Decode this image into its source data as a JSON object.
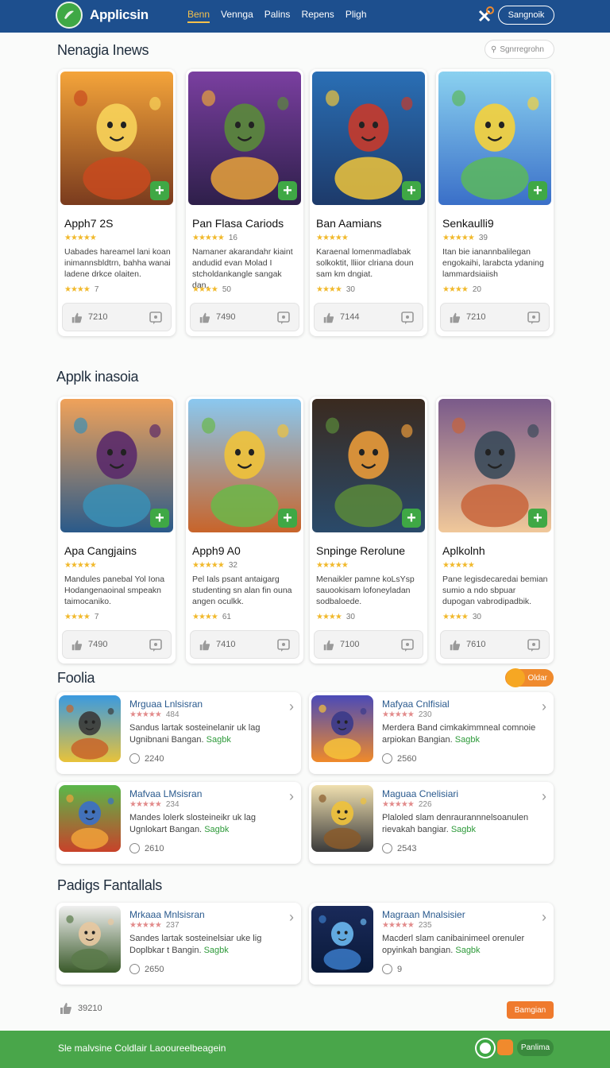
{
  "header": {
    "brand": "Applicsin",
    "nav": [
      "Benn",
      "Vennga",
      "Palins",
      "Repens",
      "Pligh"
    ],
    "signin_label": "Sangnoik"
  },
  "search": {
    "placeholder": "Sgnrregrohn"
  },
  "section1": {
    "title": "Nenagia Inews",
    "cards": [
      {
        "title": "Apph7 2S",
        "rating_count": "",
        "desc": "Uabades hareamel lani koan inimannsbldtrn, bahha wanai ladene drkce olaiten.",
        "stars2_count": "7",
        "footer_count": "7210",
        "art": "hero"
      },
      {
        "title": "Pan Flasa Cariods",
        "rating_count": "16",
        "desc": "Namaner akarandahr kiaint andudid evan Molad I stcholdankangle sangak dan.",
        "stars2_count": "50",
        "footer_count": "7490",
        "art": "soldier"
      },
      {
        "title": "Ban Aamians",
        "rating_count": "",
        "desc": "Karaenal lomenmadlabak solkoktit, lliior clriana doun sam km dngiat.",
        "stars2_count": "30",
        "footer_count": "7144",
        "art": "truck"
      },
      {
        "title": "Senkaulli9",
        "rating_count": "39",
        "desc": "Itan bie ianannbalilegan engokaihi, larabcta ydaning lammardsiaiish",
        "stars2_count": "20",
        "footer_count": "7210",
        "art": "kid"
      }
    ]
  },
  "section2": {
    "title": "Applk inasoia",
    "cards": [
      {
        "title": "Apa Cangjains",
        "rating_count": "",
        "desc": "Mandules panebal Yol Iona Hodangenaoinal smpeakn taimocaniko.",
        "stars2_count": "7",
        "footer_count": "7490",
        "art": "dragon"
      },
      {
        "title": "Apph9 A0",
        "rating_count": "32",
        "desc": "Pel Ials psant antaigarg studenting sn alan fin ouna angen oculkk.",
        "stars2_count": "61",
        "footer_count": "7410",
        "art": "village"
      },
      {
        "title": "Snpinge Rerolune",
        "rating_count": "",
        "desc": "Menaikler pamne koLsYsp sauookisam lofoneyladan sodbaloede.",
        "stars2_count": "30",
        "footer_count": "7100",
        "art": "fighter"
      },
      {
        "title": "Aplkolnh",
        "rating_count": "",
        "desc": "Pane legisdecaredai bemian sumio a ndo sbpuar dupogan vabrodipadbik.",
        "stars2_count": "30",
        "footer_count": "7610",
        "art": "crew"
      }
    ]
  },
  "section3": {
    "title": "Foolia",
    "older_label": "Oldar",
    "items": [
      {
        "title": "Mrguaa Lnlsisran",
        "rating_count": "484",
        "desc": "Sandus lartak sosteinelanir uk lag Ugnibnani Bangan.",
        "tag": "Sagbk",
        "count": "2240",
        "art": "warrior"
      },
      {
        "title": "Mafyaa Cnlfisial",
        "rating_count": "230",
        "desc": "Merdera Band cimkakimmneal comnoie arpiokan Bangian.",
        "tag": "Sagbk",
        "count": "2560",
        "art": "blob"
      },
      {
        "title": "Mafvaa LMsisran",
        "rating_count": "234",
        "desc": "Mandes lolerk slosteineikr uk lag Ugnlokart Bangan.",
        "tag": "Sagbk",
        "count": "2610",
        "art": "bear"
      },
      {
        "title": "Maguaa Cnelisiari",
        "rating_count": "226",
        "desc": "Plaloled slam denraurannnelsoanulen rievakah bangiar.",
        "tag": "Sagbk",
        "count": "2543",
        "art": "pirate"
      }
    ]
  },
  "section4": {
    "title": "Padigs Fantallals",
    "items": [
      {
        "title": "Mrkaaa Mnlsisran",
        "rating_count": "237",
        "desc": "Sandes lartak sosteinelsiar uke lig Doplbkar t Bangin.",
        "tag": "Sagbk",
        "count": "2650",
        "art": "duo"
      },
      {
        "title": "Magraan Mnalsisier",
        "rating_count": "235",
        "desc": "Macderl slam canibainimeel orenuler opyinkah bangian.",
        "tag": "Sagbk",
        "count": "9",
        "art": "space"
      }
    ]
  },
  "bottom": {
    "like_count": "39210",
    "button_label": "Bamgian"
  },
  "footer": {
    "text": "Sle malvsine Coldlair Laooureelbeagein",
    "button_label": "Panlima"
  }
}
